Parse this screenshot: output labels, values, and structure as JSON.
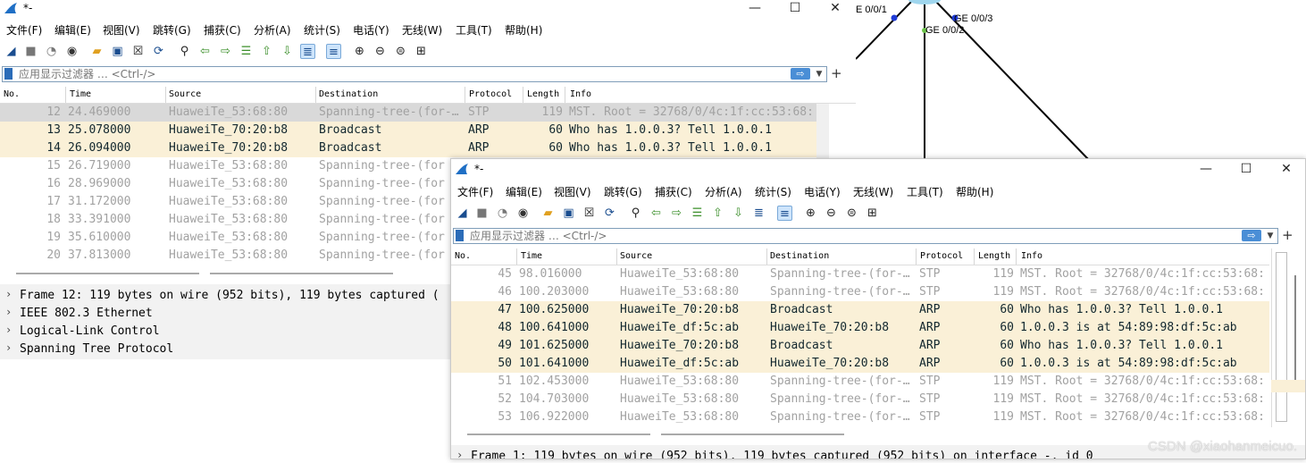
{
  "topology": {
    "ports": [
      "E 0/0/1",
      "GE 0/0/3",
      "GE 0/0/2"
    ]
  },
  "back_window": {
    "title": "*-",
    "controls": [
      "—",
      "☐",
      "✕"
    ],
    "menu": [
      "文件(F)",
      "编辑(E)",
      "视图(V)",
      "跳转(G)",
      "捕获(C)",
      "分析(A)",
      "统计(S)",
      "电话(Y)",
      "无线(W)",
      "工具(T)",
      "帮助(H)"
    ],
    "filter": {
      "placeholder": "应用显示过滤器 … <Ctrl-/>",
      "apply": "⇨",
      "plus": "+"
    },
    "columns": [
      "No.",
      "Time",
      "Source",
      "Destination",
      "Protocol",
      "Length",
      "Info"
    ],
    "packets": [
      {
        "no": "12",
        "time": "24.469000",
        "src": "HuaweiTe_53:68:80",
        "dst": "Spanning-tree-(for-…",
        "proto": "STP",
        "len": "119",
        "info": "MST. Root = 32768/0/4c:1f:cc:53:68:",
        "kind": "sel"
      },
      {
        "no": "13",
        "time": "25.078000",
        "src": "HuaweiTe_70:20:b8",
        "dst": "Broadcast",
        "proto": "ARP",
        "len": "60",
        "info": "Who has 1.0.0.3? Tell 1.0.0.1",
        "kind": "arp"
      },
      {
        "no": "14",
        "time": "26.094000",
        "src": "HuaweiTe_70:20:b8",
        "dst": "Broadcast",
        "proto": "ARP",
        "len": "60",
        "info": "Who has 1.0.0.3? Tell 1.0.0.1",
        "kind": "arp"
      },
      {
        "no": "15",
        "time": "26.719000",
        "src": "HuaweiTe_53:68:80",
        "dst": "Spanning-tree-(for",
        "proto": "",
        "len": "",
        "info": "",
        "kind": "stp"
      },
      {
        "no": "16",
        "time": "28.969000",
        "src": "HuaweiTe_53:68:80",
        "dst": "Spanning-tree-(for",
        "proto": "",
        "len": "",
        "info": "",
        "kind": "stp"
      },
      {
        "no": "17",
        "time": "31.172000",
        "src": "HuaweiTe_53:68:80",
        "dst": "Spanning-tree-(for",
        "proto": "",
        "len": "",
        "info": "",
        "kind": "stp"
      },
      {
        "no": "18",
        "time": "33.391000",
        "src": "HuaweiTe_53:68:80",
        "dst": "Spanning-tree-(for",
        "proto": "",
        "len": "",
        "info": "",
        "kind": "stp"
      },
      {
        "no": "19",
        "time": "35.610000",
        "src": "HuaweiTe_53:68:80",
        "dst": "Spanning-tree-(for",
        "proto": "",
        "len": "",
        "info": "",
        "kind": "stp"
      },
      {
        "no": "20",
        "time": "37.813000",
        "src": "HuaweiTe_53:68:80",
        "dst": "Spanning-tree-(for",
        "proto": "",
        "len": "",
        "info": "",
        "kind": "stp"
      }
    ],
    "details": [
      "Frame 12: 119 bytes on wire (952 bits), 119 bytes captured (",
      "IEEE 802.3 Ethernet",
      "Logical-Link Control",
      "Spanning Tree Protocol"
    ]
  },
  "front_window": {
    "title": "*-",
    "controls": [
      "—",
      "☐",
      "✕"
    ],
    "menu": [
      "文件(F)",
      "编辑(E)",
      "视图(V)",
      "跳转(G)",
      "捕获(C)",
      "分析(A)",
      "统计(S)",
      "电话(Y)",
      "无线(W)",
      "工具(T)",
      "帮助(H)"
    ],
    "filter": {
      "placeholder": "应用显示过滤器 … <Ctrl-/>",
      "apply": "⇨",
      "plus": "+"
    },
    "columns": [
      "No.",
      "Time",
      "Source",
      "Destination",
      "Protocol",
      "Length",
      "Info"
    ],
    "packets": [
      {
        "no": "45",
        "time": "98.016000",
        "src": "HuaweiTe_53:68:80",
        "dst": "Spanning-tree-(for-…",
        "proto": "STP",
        "len": "119",
        "info": "MST. Root = 32768/0/4c:1f:cc:53:68:",
        "kind": "stp"
      },
      {
        "no": "46",
        "time": "100.203000",
        "src": "HuaweiTe_53:68:80",
        "dst": "Spanning-tree-(for-…",
        "proto": "STP",
        "len": "119",
        "info": "MST. Root = 32768/0/4c:1f:cc:53:68:",
        "kind": "stp"
      },
      {
        "no": "47",
        "time": "100.625000",
        "src": "HuaweiTe_70:20:b8",
        "dst": "Broadcast",
        "proto": "ARP",
        "len": "60",
        "info": "Who has 1.0.0.3? Tell 1.0.0.1",
        "kind": "arp"
      },
      {
        "no": "48",
        "time": "100.641000",
        "src": "HuaweiTe_df:5c:ab",
        "dst": "HuaweiTe_70:20:b8",
        "proto": "ARP",
        "len": "60",
        "info": "1.0.0.3 is at 54:89:98:df:5c:ab",
        "kind": "arp"
      },
      {
        "no": "49",
        "time": "101.625000",
        "src": "HuaweiTe_70:20:b8",
        "dst": "Broadcast",
        "proto": "ARP",
        "len": "60",
        "info": "Who has 1.0.0.3? Tell 1.0.0.1",
        "kind": "arp"
      },
      {
        "no": "50",
        "time": "101.641000",
        "src": "HuaweiTe_df:5c:ab",
        "dst": "HuaweiTe_70:20:b8",
        "proto": "ARP",
        "len": "60",
        "info": "1.0.0.3 is at 54:89:98:df:5c:ab",
        "kind": "arp"
      },
      {
        "no": "51",
        "time": "102.453000",
        "src": "HuaweiTe_53:68:80",
        "dst": "Spanning-tree-(for-…",
        "proto": "STP",
        "len": "119",
        "info": "MST. Root = 32768/0/4c:1f:cc:53:68:",
        "kind": "stp"
      },
      {
        "no": "52",
        "time": "104.703000",
        "src": "HuaweiTe_53:68:80",
        "dst": "Spanning-tree-(for-…",
        "proto": "STP",
        "len": "119",
        "info": "MST. Root = 32768/0/4c:1f:cc:53:68:",
        "kind": "stp"
      },
      {
        "no": "53",
        "time": "106.922000",
        "src": "HuaweiTe_53:68:80",
        "dst": "Spanning-tree-(for-…",
        "proto": "STP",
        "len": "119",
        "info": "MST. Root = 32768/0/4c:1f:cc:53:68:",
        "kind": "stp"
      }
    ],
    "details": [
      "Frame 1: 119 bytes on wire (952 bits), 119 bytes captured (952 bits) on interface -, id 0"
    ]
  },
  "watermark": "CSDN @xiaohanmeicuo.",
  "colors": {
    "arp_bg": "#faf0d7",
    "stp_fg": "#a2a2a2",
    "selected_bg": "#d9d9d9"
  }
}
